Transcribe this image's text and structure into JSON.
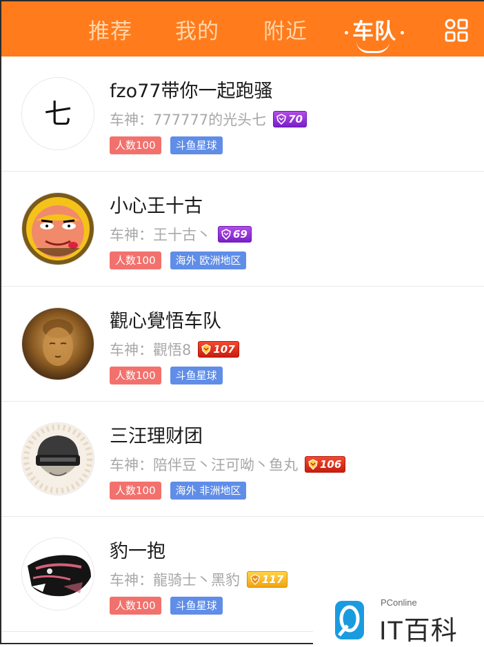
{
  "tabs": [
    {
      "label": "推荐",
      "active": false
    },
    {
      "label": "我的",
      "active": false
    },
    {
      "label": "附近",
      "active": false
    },
    {
      "label": "车队",
      "active": true
    }
  ],
  "menu_icon": "grid-icon",
  "teams": [
    {
      "name": "fzo77带你一起跑骚",
      "leader": "车神：777777的光头七",
      "level": "70",
      "level_color": "purple",
      "tags": [
        "人数100",
        "斗鱼星球"
      ],
      "avatar": "七"
    },
    {
      "name": "小心王十古",
      "leader": "车神：王十古丶",
      "level": "69",
      "level_color": "purple",
      "tags": [
        "人数100",
        "海外 欧洲地区"
      ],
      "avatar": "cartoon-face"
    },
    {
      "name": "觀心覺悟车队",
      "leader": "车神：觀悟8",
      "level": "107",
      "level_color": "red",
      "tags": [
        "人数100",
        "斗鱼星球"
      ],
      "avatar": "buddha"
    },
    {
      "name": "三汪理财团",
      "leader": "车神：陪伴豆丶汪可呦丶鱼丸",
      "level": "106",
      "level_color": "red",
      "tags": [
        "人数100",
        "海外 非洲地区"
      ],
      "avatar": "helmet"
    },
    {
      "name": "豹一抱",
      "leader": "车神：龍骑士丶黑豹",
      "level": "117",
      "level_color": "gold",
      "tags": [
        "人数100",
        "斗鱼星球"
      ],
      "avatar": "panther"
    }
  ],
  "watermark": {
    "small": "PConline",
    "big": "IT百科"
  },
  "colors": {
    "header": "#ff7b1c",
    "tag_red": "#f2716c",
    "tag_blue": "#5f8de8"
  }
}
